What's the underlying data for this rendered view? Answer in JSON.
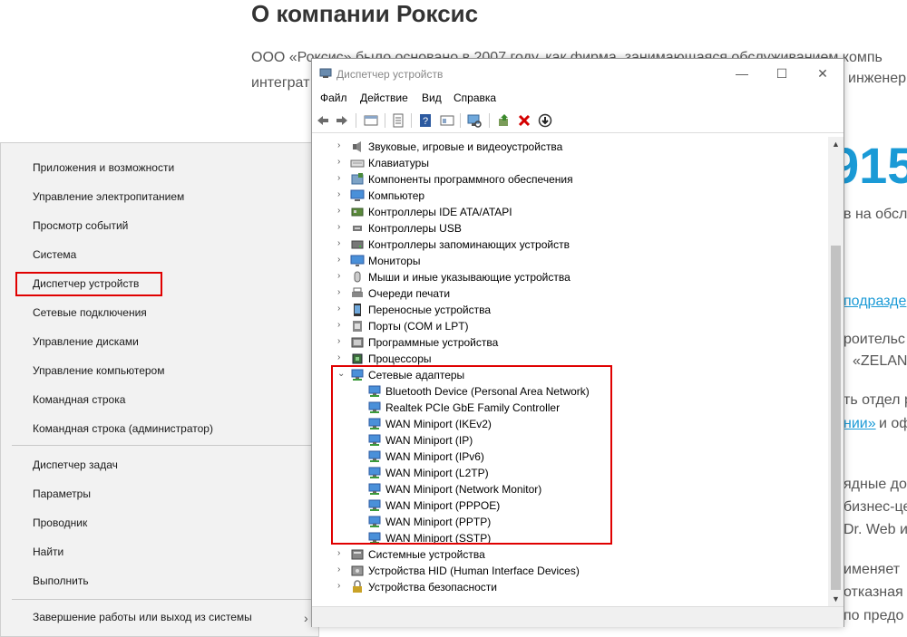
{
  "background": {
    "heading": "О компании Роксис",
    "paragraph_line1": "ООО «Роксис» было основано в 2007 году, как фирма, занимающаяся обслуживанием компь",
    "paragraph_line2": "интеграт",
    "paragraph_line2_end": "инженери",
    "big_number": "915",
    "frag1": "в на обслу",
    "frag2": "подразде",
    "frag3": "роительс",
    "frag4": "«ZELAN",
    "frag5": "ть отдел р",
    "frag6": "нии»",
    "frag6b": "и оф",
    "frag7": "ядные до",
    "frag8": "бизнес-це",
    "frag9": "Dr. Web и",
    "frag10": "именяет",
    "frag11": "отказная",
    "frag12": "по предо"
  },
  "context_menu": {
    "group1": [
      "Приложения и возможности",
      "Управление электропитанием",
      "Просмотр событий",
      "Система",
      "Диспетчер устройств",
      "Сетевые подключения",
      "Управление дисками",
      "Управление компьютером",
      "Командная строка",
      "Командная строка (администратор)"
    ],
    "group2": [
      "Диспетчер задач",
      "Параметры",
      "Проводник",
      "Найти",
      "Выполнить"
    ],
    "shutdown_label": "Завершение работы или выход из системы",
    "shutdown_arrow": "›"
  },
  "window": {
    "title": "Диспетчер устройств",
    "minimize": "—",
    "maximize": "☐",
    "close": "✕",
    "menu": [
      "Файл",
      "Действие",
      "Вид",
      "Справка"
    ],
    "tree": [
      {
        "label": "Звуковые, игровые и видеоустройства",
        "icon": "speaker-icon",
        "level": 0,
        "expander": "›"
      },
      {
        "label": "Клавиатуры",
        "icon": "keyboard-icon",
        "level": 0,
        "expander": "›"
      },
      {
        "label": "Компоненты программного обеспечения",
        "icon": "software-icon",
        "level": 0,
        "expander": "›"
      },
      {
        "label": "Компьютер",
        "icon": "computer-icon",
        "level": 0,
        "expander": "›"
      },
      {
        "label": "Контроллеры IDE ATA/ATAPI",
        "icon": "ide-controller-icon",
        "level": 0,
        "expander": "›"
      },
      {
        "label": "Контроллеры USB",
        "icon": "usb-icon",
        "level": 0,
        "expander": "›"
      },
      {
        "label": "Контроллеры запоминающих устройств",
        "icon": "storage-controller-icon",
        "level": 0,
        "expander": "›"
      },
      {
        "label": "Мониторы",
        "icon": "monitor-icon",
        "level": 0,
        "expander": "›"
      },
      {
        "label": "Мыши и иные указывающие устройства",
        "icon": "mouse-icon",
        "level": 0,
        "expander": "›"
      },
      {
        "label": "Очереди печати",
        "icon": "printer-icon",
        "level": 0,
        "expander": "›"
      },
      {
        "label": "Переносные устройства",
        "icon": "portable-device-icon",
        "level": 0,
        "expander": "›"
      },
      {
        "label": "Порты (COM и LPT)",
        "icon": "port-icon",
        "level": 0,
        "expander": "›"
      },
      {
        "label": "Программные устройства",
        "icon": "software-device-icon",
        "level": 0,
        "expander": "›"
      },
      {
        "label": "Процессоры",
        "icon": "processor-icon",
        "level": 0,
        "expander": "›"
      },
      {
        "label": "Сетевые адаптеры",
        "icon": "network-adapter-icon",
        "level": 0,
        "expander": "⌄"
      },
      {
        "label": "Bluetooth Device (Personal Area Network)",
        "icon": "network-adapter-icon",
        "level": 1,
        "expander": ""
      },
      {
        "label": "Realtek PCIe GbE Family Controller",
        "icon": "network-adapter-icon",
        "level": 1,
        "expander": ""
      },
      {
        "label": "WAN Miniport (IKEv2)",
        "icon": "network-adapter-icon",
        "level": 1,
        "expander": ""
      },
      {
        "label": "WAN Miniport (IP)",
        "icon": "network-adapter-icon",
        "level": 1,
        "expander": ""
      },
      {
        "label": "WAN Miniport (IPv6)",
        "icon": "network-adapter-icon",
        "level": 1,
        "expander": ""
      },
      {
        "label": "WAN Miniport (L2TP)",
        "icon": "network-adapter-icon",
        "level": 1,
        "expander": ""
      },
      {
        "label": "WAN Miniport (Network Monitor)",
        "icon": "network-adapter-icon",
        "level": 1,
        "expander": ""
      },
      {
        "label": "WAN Miniport (PPPOE)",
        "icon": "network-adapter-icon",
        "level": 1,
        "expander": ""
      },
      {
        "label": "WAN Miniport (PPTP)",
        "icon": "network-adapter-icon",
        "level": 1,
        "expander": ""
      },
      {
        "label": "WAN Miniport (SSTP)",
        "icon": "network-adapter-icon",
        "level": 1,
        "expander": ""
      },
      {
        "label": "Системные устройства",
        "icon": "system-device-icon",
        "level": 0,
        "expander": "›"
      },
      {
        "label": "Устройства HID (Human Interface Devices)",
        "icon": "hid-icon",
        "level": 0,
        "expander": "›"
      },
      {
        "label": "Устройства безопасности",
        "icon": "security-device-icon",
        "level": 0,
        "expander": "›"
      }
    ],
    "scroll_up": "▲",
    "scroll_down": "▼"
  },
  "colors": {
    "highlight_red": "#e00000",
    "link_blue": "#1a9ad6"
  }
}
